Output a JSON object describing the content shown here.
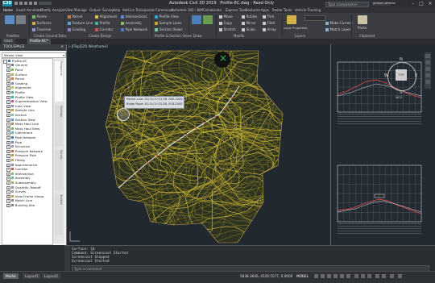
{
  "app": {
    "badge": "C3D",
    "title": "Autodesk Civil 3D 2019",
    "file": "Profile-6C.dwg - Read Only",
    "search_placeholder": "Type a keyword or phrase",
    "user": "graham.wheeler"
  },
  "ribbon_tabs": [
    "Home",
    "Insert",
    "Annotate",
    "Modify",
    "Analyze",
    "View",
    "Manage",
    "Output",
    "Survey",
    "Help",
    "Add-ins",
    "Transparent Commands",
    "Autodesk 360 / BIM",
    "Collaborate",
    "Express Tools",
    "Featured Apps",
    "Raster Tools",
    "Vehicle Tracking"
  ],
  "active_ribbon_tab": "Home",
  "ribbon": {
    "points": "Points",
    "surfaces": "Surfaces",
    "traverse": "Traverse",
    "parcel": "Parcel",
    "feature_line": "Feature Line",
    "grading": "Grading",
    "alignment": "Alignment",
    "profile": "Profile",
    "corridor": "Corridor",
    "intersections": "Intersections",
    "assembly": "Assembly",
    "pipe_network": "Pipe Network",
    "profile_view": "Profile View",
    "sample_lines": "Sample Lines",
    "section_views": "Section Views",
    "move": "Move",
    "copy": "Copy",
    "stretch": "Stretch",
    "rotate": "Rotate",
    "mirror": "Mirror",
    "scale": "Scale",
    "trim": "Trim",
    "fillet": "Fillet",
    "array": "Array",
    "layer_properties": "Layer Properties",
    "make_current": "Make Current",
    "match_layer": "Match Layer",
    "paste": "Paste",
    "panels": [
      "Palettes",
      "Create Ground Data",
      "Create Design",
      "Profile & Section Views",
      "Draw",
      "Modify",
      "Layers",
      "Clipboard"
    ]
  },
  "doc_tabs": [
    "Start",
    "Profile-6C*"
  ],
  "active_doc_tab": "Profile-6C*",
  "toolspace": {
    "title": "TOOLSPACE",
    "view_dropdown": "Master View",
    "root": "Profile-6C",
    "items": [
      "General",
      "Point",
      "Surface",
      "Parcel",
      "Grading",
      "Alignment",
      "Profile",
      "Profile View",
      "Superelevation View",
      "Cant View",
      "Sample Line",
      "Section",
      "Section View",
      "Mass Haul Line",
      "Mass Haul View",
      "Catchment",
      "Pipe Network",
      "Pipe",
      "Structure",
      "Pressure Network",
      "Pressure Pipe",
      "Fitting",
      "Appurtenance",
      "Corridor",
      "Intersection",
      "Assembly",
      "Subassembly",
      "Quantity Takeoff",
      "Survey",
      "View Frame Group",
      "Match Line",
      "Building Site"
    ],
    "side_tabs": [
      "Prospector",
      "Settings",
      "Survey",
      "Toolbox"
    ]
  },
  "viewport": {
    "label": "[-][Top][2D Wireframe]"
  },
  "tooltip": {
    "line1": "Parent Line:   OG   S=2+21.58   -990.2000",
    "line2": "Ridge Road:   EG   S=2+21.58   -918.2000"
  },
  "viewcube": {
    "north": "N",
    "south": "S",
    "east": "E",
    "west": "W",
    "face": "TOP",
    "wcs": "WCS"
  },
  "command": {
    "lines": [
      "Surface: 10",
      "Command: Screencast Started",
      "Screencast Stopped",
      "Screencast Started"
    ],
    "input_placeholder": "Type a command"
  },
  "status": {
    "tabs": [
      "Model",
      "Layout1",
      "Layout2"
    ],
    "active_tab": "Model",
    "coords": "5838.3606, 4526.5577, 0.0000",
    "space": "MODEL"
  },
  "colors": {
    "contour": "#b8a82a",
    "alignment": "#e8e8e8",
    "background": "#212830",
    "accent": "#138a9f",
    "profile_red": "#d64b4b"
  }
}
